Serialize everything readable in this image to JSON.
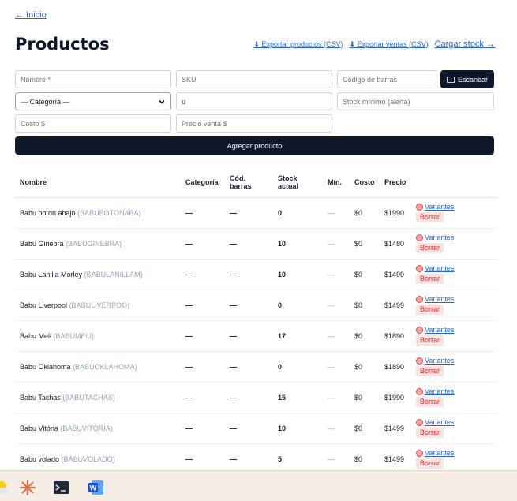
{
  "nav": {
    "back_label": "← Inicio"
  },
  "page": {
    "title": "Productos"
  },
  "actions": {
    "export_products": "⬇ Exportar productos (CSV)",
    "export_sales": "⬇ Exportar ventas (CSV)",
    "load_stock": "Cargar stock →"
  },
  "form": {
    "name_placeholder": "Nombre *",
    "sku_placeholder": "SKU",
    "barcode_placeholder": "Código de barras",
    "scan_label": "Escanear",
    "category_selected": "— Categoría —",
    "search_value": "u",
    "min_stock_placeholder": "Stock mínimo (alerta)",
    "cost_placeholder": "Costo $",
    "price_placeholder": "Precio venta $",
    "add_label": "Agregar producto"
  },
  "table": {
    "headers": {
      "name": "Nombre",
      "category": "Categoría",
      "barcode_line1": "Cód.",
      "barcode_line2": "barras",
      "stock_line1": "Stock",
      "stock_line2": "actual",
      "min": "Mín.",
      "cost": "Costo",
      "price": "Precio"
    },
    "variants_label": "Variantes",
    "delete_label": "Borrar",
    "rows": [
      {
        "name": "Babu boton abajo",
        "sku": "(BABUBOTONABA)",
        "category": "—",
        "barcode": "—",
        "stock": "0",
        "min": "—",
        "cost": "$0",
        "price": "$1990"
      },
      {
        "name": "Babu Ginebra",
        "sku": "(BABUGINEBRA)",
        "category": "—",
        "barcode": "—",
        "stock": "10",
        "min": "—",
        "cost": "$0",
        "price": "$1480"
      },
      {
        "name": "Babu Lanilla Morley",
        "sku": "(BABULANILLAM)",
        "category": "—",
        "barcode": "—",
        "stock": "10",
        "min": "—",
        "cost": "$0",
        "price": "$1499"
      },
      {
        "name": "Babu Liverpool",
        "sku": "(BABULIVERPOO)",
        "category": "—",
        "barcode": "—",
        "stock": "0",
        "min": "—",
        "cost": "$0",
        "price": "$1499"
      },
      {
        "name": "Babu Meli",
        "sku": "(BABUMELI)",
        "category": "—",
        "barcode": "—",
        "stock": "17",
        "min": "—",
        "cost": "$0",
        "price": "$1890"
      },
      {
        "name": "Babu Oklahoma",
        "sku": "(BABUOKLAHOMA)",
        "category": "—",
        "barcode": "—",
        "stock": "0",
        "min": "—",
        "cost": "$0",
        "price": "$1890"
      },
      {
        "name": "Babu Tachas",
        "sku": "(BABUTACHAS)",
        "category": "—",
        "barcode": "—",
        "stock": "15",
        "min": "—",
        "cost": "$0",
        "price": "$1990"
      },
      {
        "name": "Babu Vitória",
        "sku": "(BABUVITORIA)",
        "category": "—",
        "barcode": "—",
        "stock": "10",
        "min": "—",
        "cost": "$0",
        "price": "$1499"
      },
      {
        "name": "Babu volado",
        "sku": "(BABUVOLADO)",
        "category": "—",
        "barcode": "—",
        "stock": "5",
        "min": "—",
        "cost": "$0",
        "price": "$1499"
      }
    ]
  },
  "taskbar": {
    "icons": [
      "weather-icon",
      "claude-icon",
      "terminal-icon",
      "word-icon"
    ]
  },
  "colors": {
    "primary_dark": "#0f172a",
    "link": "#2563eb",
    "delete_bg": "#fee2e2",
    "delete_text": "#dc2626",
    "sku_text": "#94a3b8"
  }
}
